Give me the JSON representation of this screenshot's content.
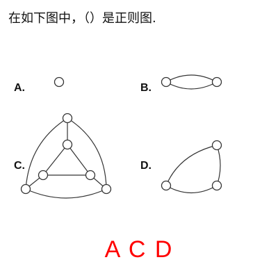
{
  "question": {
    "text": "在如下图中，（）是正则图."
  },
  "options": {
    "a_label": "A.",
    "b_label": "B.",
    "c_label": "C.",
    "d_label": "D."
  },
  "answer": {
    "text": "A C D",
    "color": "#ff0000"
  }
}
